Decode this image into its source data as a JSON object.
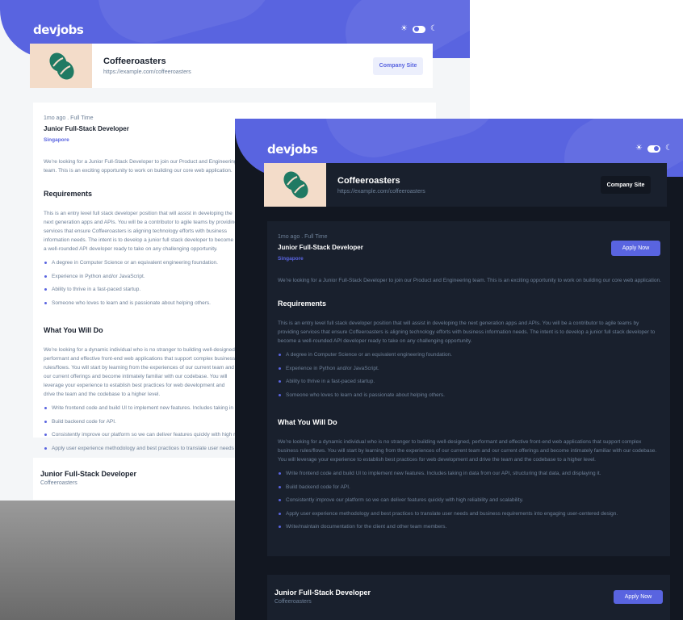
{
  "brand": {
    "logo": "devjobs",
    "primary_color": "#5964e0",
    "dark_bg": "#121721",
    "dark_card": "#19202d",
    "light_bg": "#f4f6f8",
    "logo_bg": "#f3dcc9",
    "logo_icon": "coffee-beans-icon"
  },
  "theme_toggle": {
    "sun_icon": "☀",
    "moon_icon": "☾"
  },
  "company": {
    "name": "Coffeeroasters",
    "url": "https://example.com/coffeeroasters",
    "site_button": "Company Site"
  },
  "job": {
    "posted": "1mo ago",
    "separator": " . ",
    "contract": "Full Time",
    "title": "Junior Full-Stack Developer",
    "location": "Singapore",
    "apply_label": "Apply Now",
    "description": "We’re looking for a Junior Full-Stack Developer to join our Product and Engineering team. This is an exciting opportunity to work on building our core web application.",
    "requirements_title": "Requirements",
    "requirements_text": "This is an entry level full stack developer position that will assist in developing the next generation apps and APIs. You will be a contributor to agile teams by providing services that ensure Coffeeroasters is aligning technology efforts with business information needs. The intent is to develop a junior full stack developer to become a well-rounded API developer ready to take on any challenging opportunity.",
    "requirements": [
      "A degree in Computer Science or an equivalent engineering foundation.",
      "Experience in Python and/or JavaScript.",
      "Ability to thrive in a fast-paced startup.",
      "Someone who loves to learn and is passionate about helping others."
    ],
    "role_title": "What You Will Do",
    "role_text": "We’re looking for a dynamic individual who is no stranger to building well-designed, performant and effective front-end web applications that support complex business rules/flows. You will start by learning from the experiences of our current team and our current offerings and become intimately familiar with our codebase. You will leverage your experience to establish best practices for web development and drive the team and the codebase to a higher level.",
    "role_items": [
      "Write frontend code and build UI to implement new features. Includes taking in data from our API, structuring that data, and displaying it.",
      "Build backend code for API.",
      "Consistently improve our platform so we can deliver features quickly with high reliability and scalability.",
      "Apply user experience methodology and best practices to translate user needs and business requirements into engaging user-centered design.",
      "Write/maintain documentation for the client and other team members."
    ]
  }
}
